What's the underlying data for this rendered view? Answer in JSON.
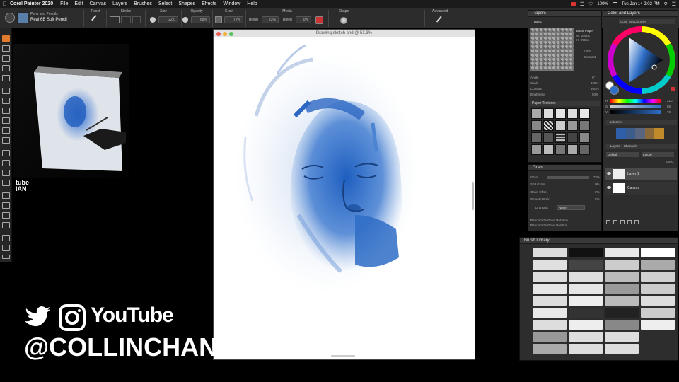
{
  "menubar": {
    "app_name": "Corel Painter 2020",
    "items": [
      "File",
      "Edit",
      "Canvas",
      "Layers",
      "Brushes",
      "Select",
      "Shapes",
      "Effects",
      "Window",
      "Help"
    ],
    "battery": "100%",
    "clock": "Tue Jan 14  2:02 PM"
  },
  "propbar": {
    "brush_category": "Pens and Pencils",
    "brush_variant": "Real 6B Soft Pencil",
    "groups": [
      "Reset",
      "Stroke",
      "Size",
      "Opacity",
      "Grain",
      "Media",
      "Shape",
      "Advanced"
    ],
    "size_value": "22.0",
    "opacity_value": "68%",
    "grain_value": "72%",
    "blend_label": "Blend",
    "blend_value": "23%",
    "bleed_label": "Bleed",
    "bleed_value": "0%"
  },
  "canvas": {
    "title": "Drawing sketch and @ 53.3%"
  },
  "papers_panel": {
    "title": "Papers",
    "tab": "Basic",
    "paper_name": "Basic Paper",
    "paper_w": "W: 256px",
    "paper_h": "H: 256px",
    "invert_label": "Invert",
    "contrast_label": "Contrast",
    "scale_label": "Scale",
    "scale_value": "100%",
    "contrast_value": "100%",
    "brightness_label": "Brightness",
    "brightness_value": "50%",
    "angle_label": "Angle",
    "angle_value": "0°",
    "textures_title": "Paper Textures"
  },
  "color_panel": {
    "title": "Color and Layers",
    "tab": "Color Set Libraries",
    "h_label": "H",
    "s_label": "S",
    "v_label": "V",
    "h_value": "210",
    "s_value": "86",
    "v_value": "79",
    "library_label": "Libraries",
    "layers_label": "Layers",
    "channels_label": "Channels",
    "composite": "Default",
    "blend_mode": "Ignore",
    "opacity": "100%",
    "layer1": "Layer 1",
    "layer2": "Canvas"
  },
  "grain_panel": {
    "title": "Grain",
    "rows": [
      {
        "label": "Grain",
        "value": "72%"
      },
      {
        "label": "Soft Grain",
        "value": "0%"
      },
      {
        "label": "Grain Offset",
        "value": "0%"
      },
      {
        "label": "Smooth Grain",
        "value": "0%"
      }
    ],
    "mode_label": "Dramatic",
    "mode_value": "None",
    "opt1": "Randomize Grain Rotation",
    "opt2": "Randomize Grain Position"
  },
  "brush_library": {
    "title": "Brush Library"
  },
  "social": {
    "youtube": "YouTube",
    "handle": "@COLLINCHAN",
    "watermark1": "tube",
    "watermark2": "IAN"
  },
  "colors": {
    "accent_blue": "#2f6fc8",
    "panel_bg": "#2d2d2d"
  }
}
